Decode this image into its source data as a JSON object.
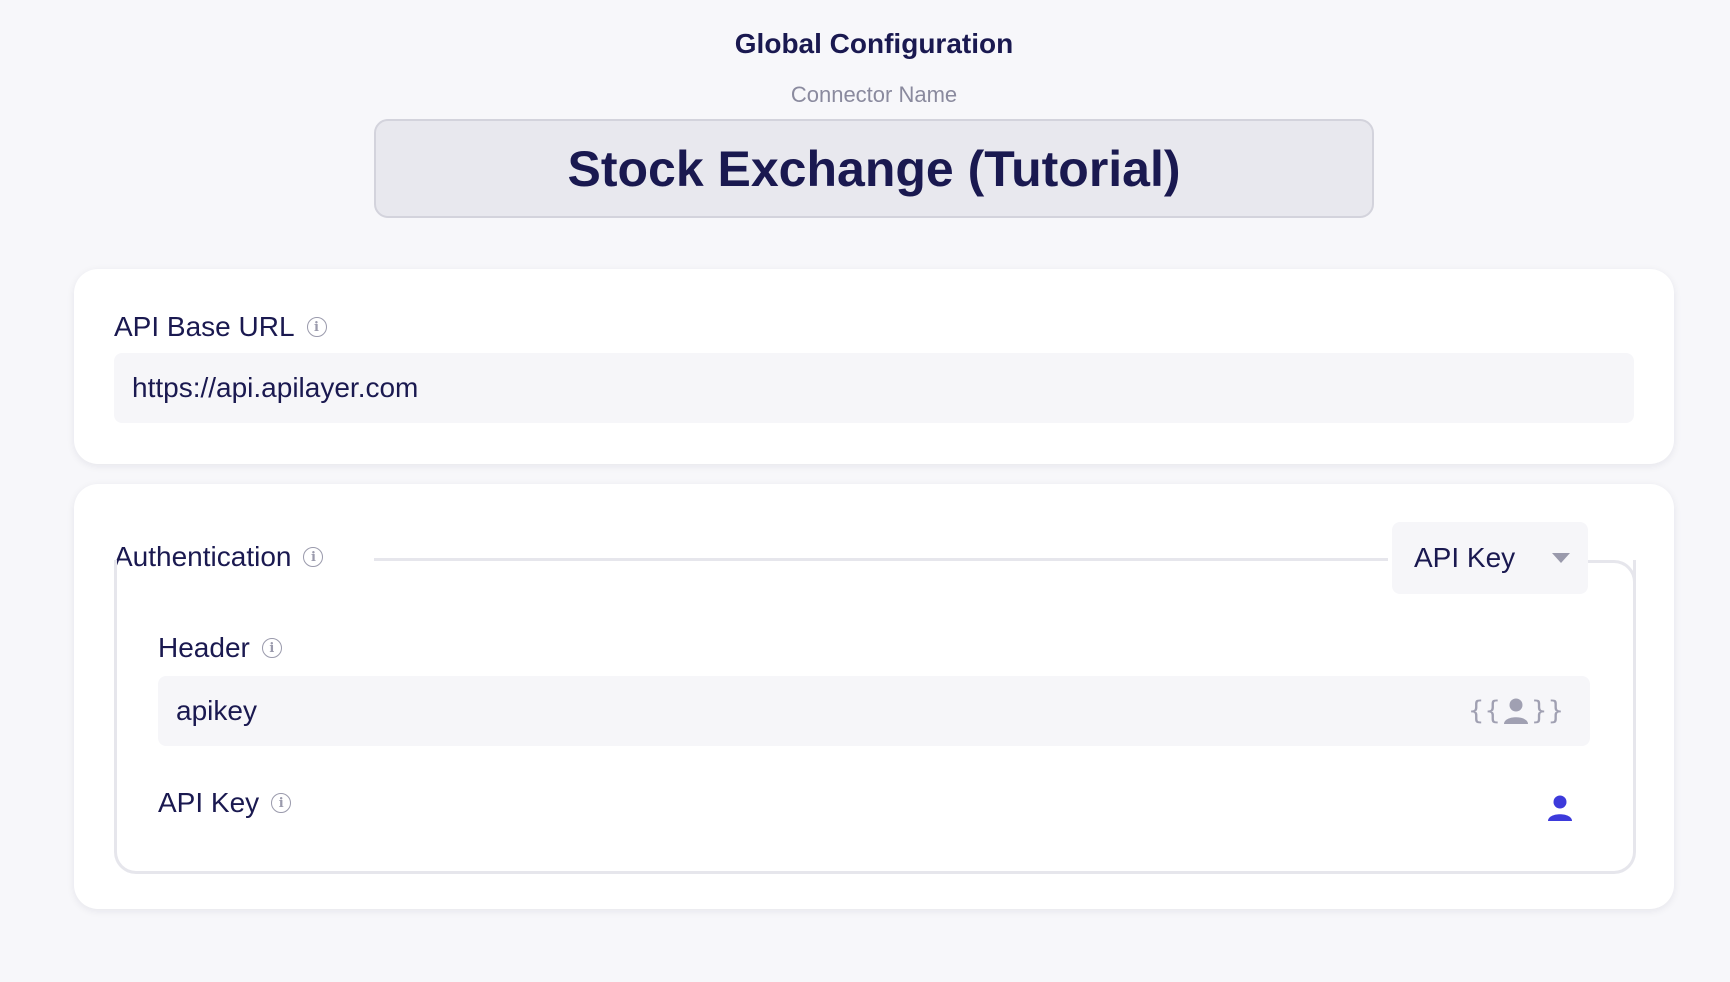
{
  "header": {
    "title": "Global Configuration",
    "connector_name_label": "Connector Name",
    "connector_name_value": "Stock Exchange (Tutorial)"
  },
  "base_url": {
    "label": "API Base URL",
    "value": "https://api.apilayer.com"
  },
  "authentication": {
    "label": "Authentication",
    "type_selected": "API Key",
    "header": {
      "label": "Header",
      "value": "apikey"
    },
    "api_key": {
      "label": "API Key"
    }
  },
  "colors": {
    "accent": "#3d3adb",
    "text": "#1a1950",
    "muted": "#8a8a9e",
    "background": "#f7f7fa"
  },
  "icons": {
    "info": "info-circle-icon",
    "dropdown": "caret-down-icon",
    "variable": "user-variable-icon",
    "user": "user-icon"
  }
}
